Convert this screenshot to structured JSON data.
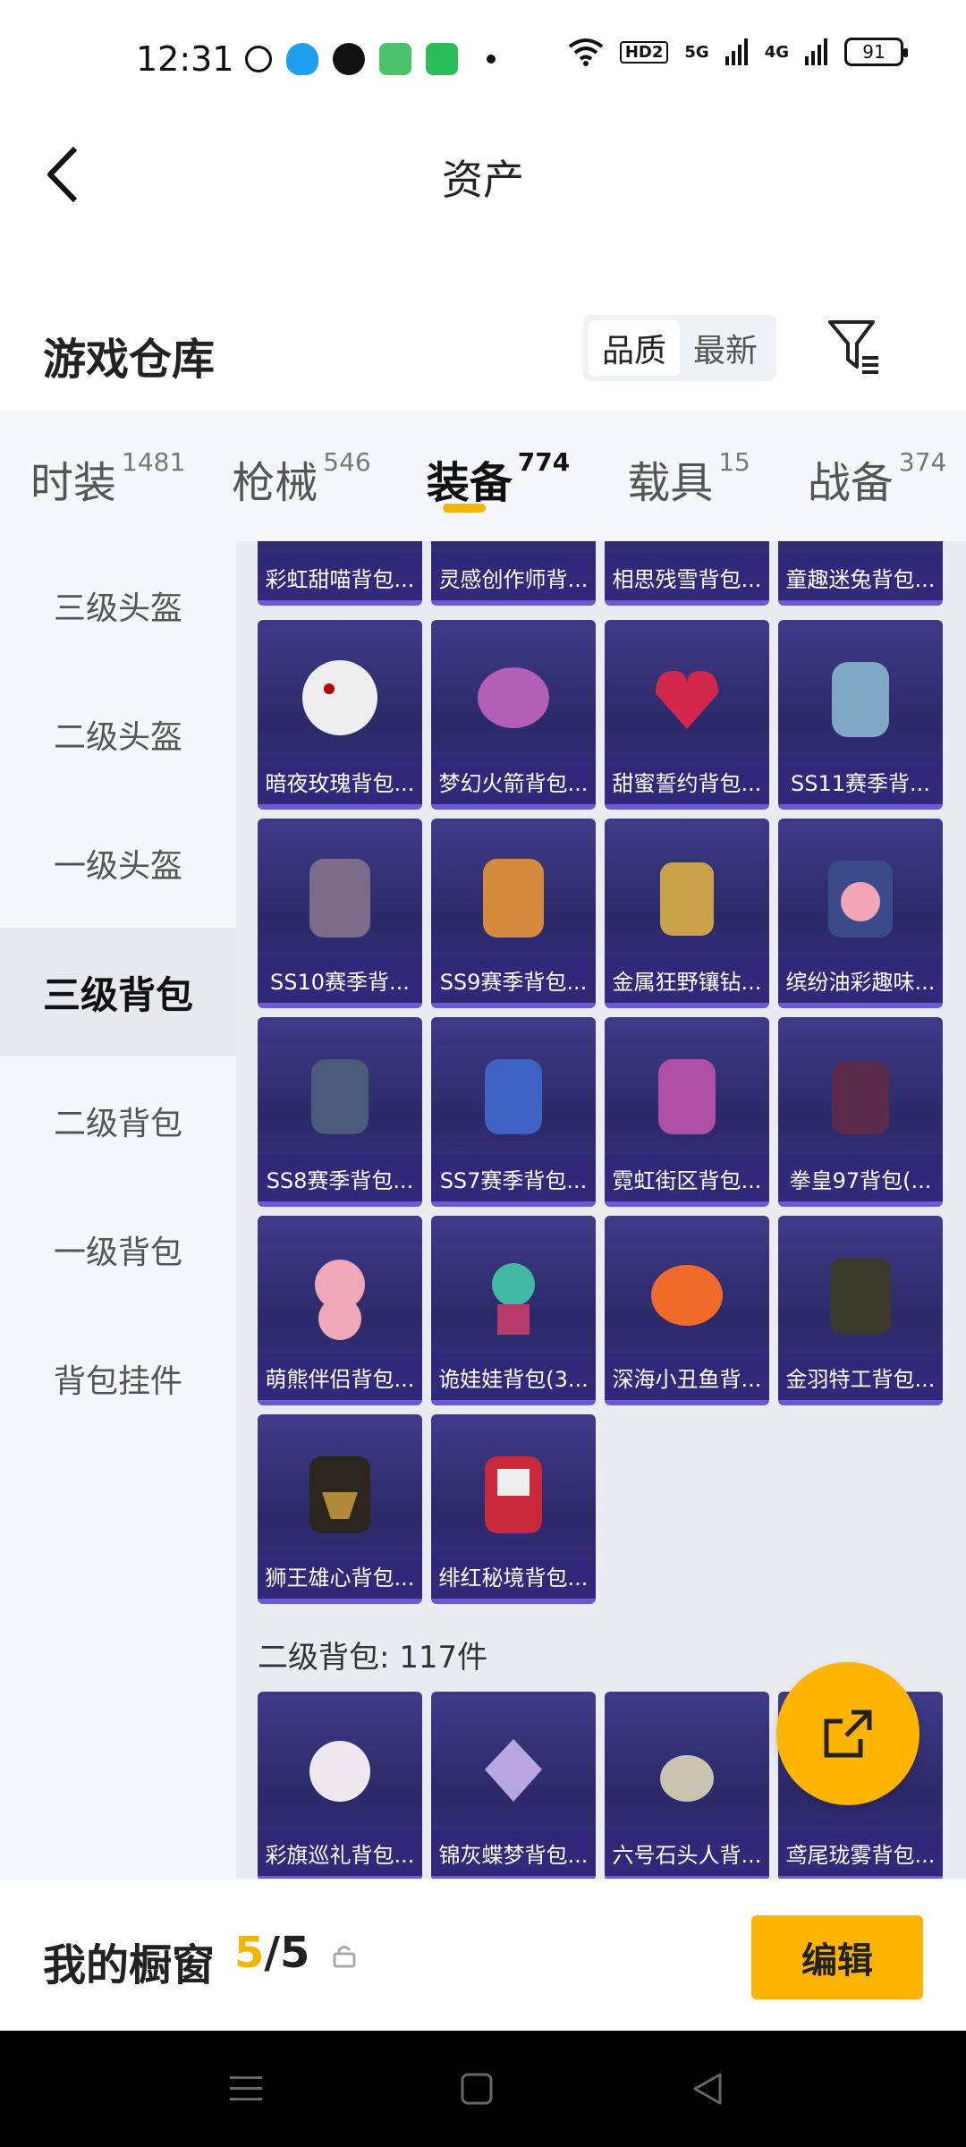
{
  "status_bar": {
    "time": "12:31",
    "battery": "91",
    "network_hd": "HD2",
    "sig5g": "5G",
    "sig4g": "4G"
  },
  "header": {
    "title": "资产",
    "back_icon": "chevron-left-icon"
  },
  "section": {
    "title": "游戏仓库",
    "sort_options": [
      "品质",
      "最新"
    ],
    "sort_selected": "品质",
    "filter_icon": "filter-icon"
  },
  "tabs": [
    {
      "label": "时装",
      "count": "1481"
    },
    {
      "label": "枪械",
      "count": "546"
    },
    {
      "label": "装备",
      "count": "774",
      "active": true
    },
    {
      "label": "载具",
      "count": "15"
    },
    {
      "label": "战备",
      "count": "374"
    }
  ],
  "sidebar": {
    "items": [
      {
        "label": "三级头盔"
      },
      {
        "label": "二级头盔"
      },
      {
        "label": "一级头盔"
      },
      {
        "label": "三级背包",
        "active": true
      },
      {
        "label": "二级背包"
      },
      {
        "label": "一级背包"
      },
      {
        "label": "背包挂件"
      }
    ]
  },
  "grid": {
    "top_row_partial": [
      "彩虹甜喵背包...",
      "灵感创作师背...",
      "相思残雪背包...",
      "童趣迷兔背包..."
    ],
    "items": [
      "暗夜玫瑰背包...",
      "梦幻火箭背包...",
      "甜蜜誓约背包...",
      "SS11赛季背...",
      "SS10赛季背...",
      "SS9赛季背包...",
      "金属狂野镶钻...",
      "缤纷油彩趣味...",
      "SS8赛季背包...",
      "SS7赛季背包...",
      "霓虹街区背包...",
      "拳皇97背包(...",
      "萌熊伴侣背包...",
      "诡娃娃背包(3...",
      "深海小丑鱼背...",
      "金羽特工背包...",
      "狮王雄心背包...",
      "绯红秘境背包..."
    ],
    "next_group_title": "二级背包: 117件",
    "next_group_items": [
      "彩旗巡礼背包...",
      "锦灰蝶梦背包...",
      "六号石头人背...",
      "鸢尾珑雾背包..."
    ]
  },
  "fab": {
    "icon": "share-icon"
  },
  "bottom_bar": {
    "label": "我的橱窗",
    "current": "5",
    "separator": "/",
    "total": "5",
    "lock_icon": "lock-icon",
    "edit_label": "编辑"
  },
  "nav": {
    "icons": [
      "menu-icon",
      "home-square-icon",
      "back-triangle-icon"
    ]
  },
  "colors": {
    "accent": "#ffb400",
    "card_bg": "#2f2d72",
    "card_border": "#6e58d6"
  }
}
